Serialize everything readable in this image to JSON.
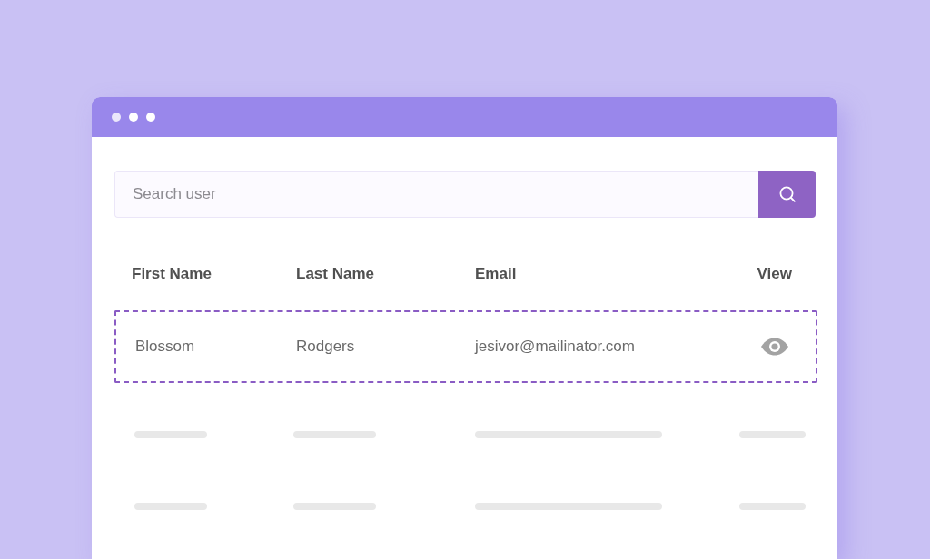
{
  "search": {
    "placeholder": "Search user"
  },
  "table": {
    "columns": [
      {
        "label": "First Name"
      },
      {
        "label": "Last Name"
      },
      {
        "label": "Email"
      },
      {
        "label": "View"
      }
    ],
    "rows": [
      {
        "selected": true,
        "cells": [
          "Blossom",
          "Rodgers",
          "jesivor@mailinator.com"
        ]
      }
    ],
    "skeleton_rows": [
      {
        "kind": "skeleton"
      },
      {
        "kind": "skeleton"
      }
    ]
  }
}
